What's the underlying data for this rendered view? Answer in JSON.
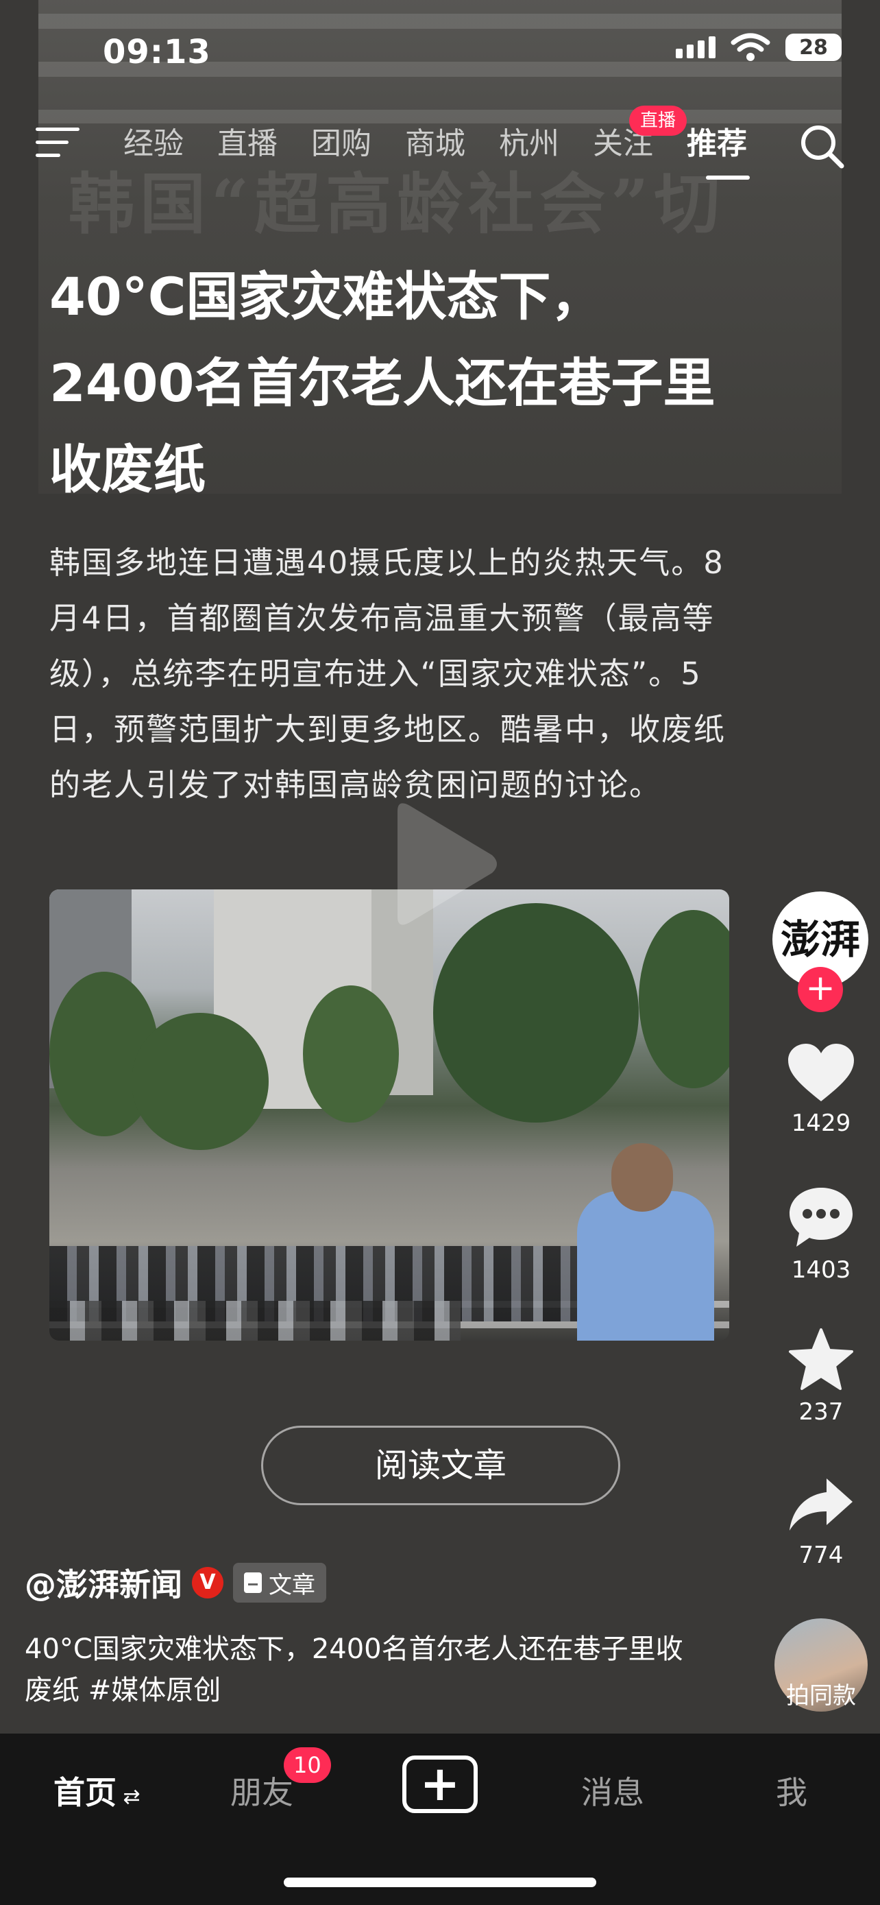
{
  "status_bar": {
    "time": "09:13",
    "battery": "28"
  },
  "nav": {
    "tabs": [
      "经验",
      "直播",
      "团购",
      "商城",
      "杭州",
      "关注",
      "推荐"
    ],
    "active_tab": "推荐",
    "live_badge": "直播"
  },
  "article": {
    "headline": "40°C国家灾难状态下，2400名首尔老人还在巷子里收废纸",
    "summary": "韩国多地连日遭遇40摄氏度以上的炎热天气。8月4日，首都圈首次发布高温重大预警（最高等级），总统李在明宣布进入“国家灾难状态”。5日，预警范围扩大到更多地区。酷暑中，收废纸的老人引发了对韩国高龄贫困问题的讨论。",
    "background_headline": "韩国“超高龄社会”切",
    "read_button": "阅读文章"
  },
  "side_actions": {
    "avatar_text": "澎湃",
    "likes": "1429",
    "comments": "1403",
    "favorites": "237",
    "shares": "774",
    "remix_label": "拍同款"
  },
  "author": {
    "name": "@澎湃新闻",
    "verified": "V",
    "type_tag": "文章"
  },
  "caption": "40°C国家灾难状态下，2400名首尔老人还在巷子里收废纸 #媒体原创",
  "bottom_nav": {
    "home": "首页",
    "friends": "朋友",
    "friends_badge": "10",
    "add": "+",
    "messages": "消息",
    "me": "我"
  },
  "colors": {
    "accent": "#fe2c55",
    "background": "#3a3937",
    "bottom_bar": "#161616"
  },
  "icons": [
    "menu-icon",
    "search-icon",
    "play-icon",
    "heart-icon",
    "comment-icon",
    "star-icon",
    "share-icon",
    "plus-icon",
    "document-icon"
  ]
}
